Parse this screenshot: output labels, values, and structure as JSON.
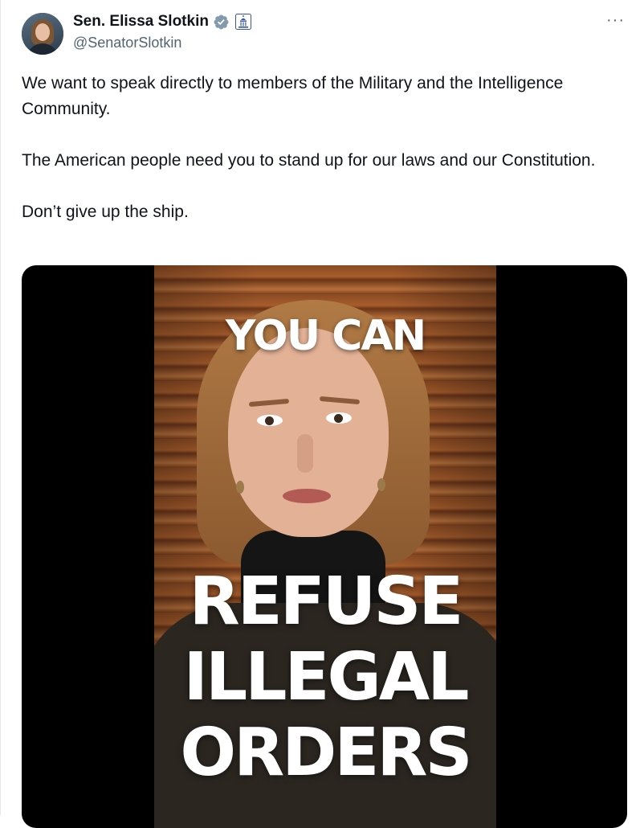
{
  "author": {
    "name": "Sen. Elissa Slotkin",
    "handle": "@SenatorSlotkin",
    "verified_icon": "verified-badge-icon",
    "affiliate_icon": "us-capitol-government-badge-icon"
  },
  "more_label": "···",
  "tweet_text": "We want to speak directly to members of the Military and the Intelligence Community.\n\nThe American people need you to stand up for our laws and our Constitution.\n\nDon’t give up the ship.",
  "media": {
    "caption_top": "YOU CAN",
    "caption_bottom": "REFUSE\nILLEGAL\nORDERS"
  },
  "colors": {
    "text_primary": "#0f1419",
    "text_secondary": "#536471",
    "verified": "#829aab"
  }
}
